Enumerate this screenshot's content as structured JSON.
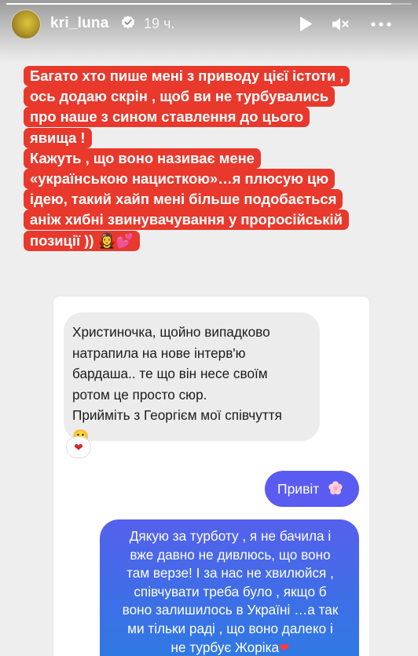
{
  "story": {
    "progress": 0.95,
    "username": "kri_luna",
    "verified": true,
    "time_ago": "19 ч."
  },
  "icons": {
    "play": "play-icon",
    "mute": "mute-icon",
    "more": "more-icon",
    "verified": "verified-badge-icon"
  },
  "caption": {
    "lines": [
      "Багато хто пише мені з приводу цієї істоти ,",
      "ось додаю скрін , щоб ви не турбувались",
      "про наше з сином ставлення до цього",
      "явища !",
      "Кажуть , що воно називає мене",
      "«українською нацисткою»…я плюсую цю",
      "ідею, такий хайп мені більше подобається",
      "аніж хибні звинувачування у проросійській",
      "позиції ))"
    ],
    "emojis": "🧛‍♀️💕",
    "background": "#e8392c"
  },
  "chat": {
    "incoming": {
      "lines": [
        "Христиночка, щойно випадково",
        "натрапила на нове інтерв'ю",
        "бардаша.. те що він несе своїм",
        "ротом це просто сюр.",
        "Прийміть з Георгієм мої співчуття"
      ],
      "emoji": "🥲",
      "reaction": "❤"
    },
    "outgoing_short": {
      "text": "Привіт",
      "emoji": "🌸"
    },
    "outgoing_long": {
      "lines": [
        "Дякую за турботу , я не бачила і",
        "вже давно не дивлюсь,  що воно",
        "там верзе! І за нас не хвилюйся ,",
        "співчувати треба було , якщо б",
        "воно залишилось в Україні …а так",
        "ми тільки раді , що воно далеко і",
        "не турбує Жоріка"
      ],
      "emoji": "❤"
    },
    "colors": {
      "incoming_bg": "#ececec",
      "outgoing_bg": "#5a5cf1"
    }
  }
}
